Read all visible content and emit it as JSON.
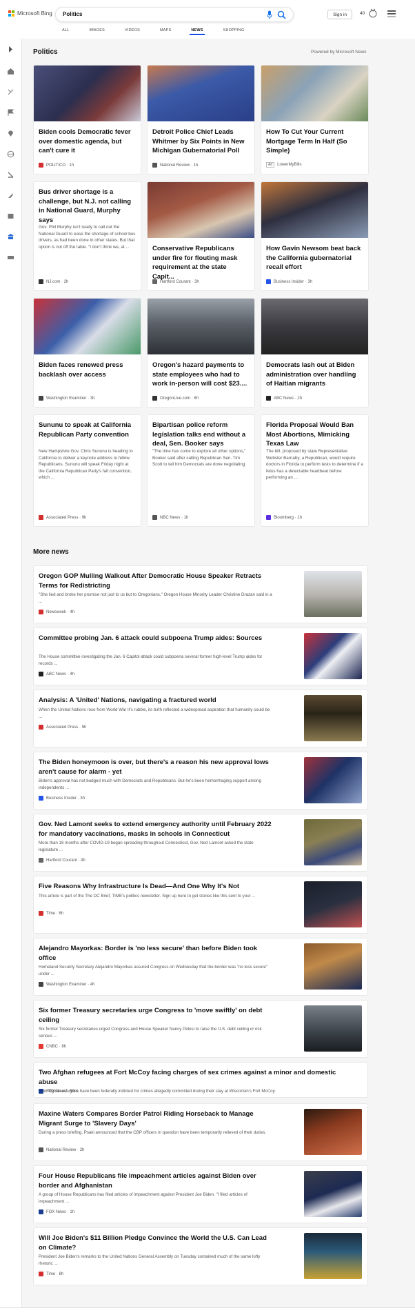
{
  "header": {
    "brand": "Microsoft Bing",
    "query": "Politics",
    "sign_in": "Sign in",
    "points": "40",
    "tabs": [
      "ALL",
      "IMAGES",
      "VIDEOS",
      "MAPS",
      "NEWS",
      "SHOPPING"
    ],
    "active_tab": "NEWS"
  },
  "politics": {
    "title": "Politics",
    "powered": "Powered by Microsoft News",
    "cards": [
      {
        "title": "Biden cools Democratic fever over domestic agenda, but can't cure it",
        "snippet": "",
        "source": "POLITICO",
        "time": "1h",
        "color": "#d32f2f"
      },
      {
        "title": "Detroit Police Chief Leads Whitmer by Six Points in New Michigan Gubernatorial Poll",
        "snippet": "",
        "source": "National Review",
        "time": "1h",
        "color": "#555555"
      },
      {
        "title": "How To Cut Your Current Mortgage Term In Half (So Simple)",
        "snippet": "",
        "source": "LowerMyBills",
        "time": "",
        "ad": "Ad",
        "color": "#888888"
      },
      {
        "title": "Bus driver shortage is a challenge, but N.J. not calling in National Guard, Murphy says",
        "snippet": "Gov. Phil Murphy isn't ready to call out the National Guard to ease the shortage of school bus drivers, as had been done in other states. But that option is not off the table. \"I don't think we, at ...",
        "source": "NJ.com",
        "time": "2h",
        "color": "#333333"
      },
      {
        "title": "Conservative Republicans under fire for flouting mask requirement at the state Capit...",
        "snippet": "",
        "source": "Hartford Courant",
        "time": "3h",
        "color": "#666666"
      },
      {
        "title": "How Gavin Newsom beat back the California gubernatorial recall effort",
        "snippet": "",
        "source": "Business Insider",
        "time": "3h",
        "color": "#2455e6"
      },
      {
        "title": "Biden faces renewed press backlash over access",
        "snippet": "",
        "source": "Washington Examiner",
        "time": "3h",
        "color": "#444444"
      },
      {
        "title": "Oregon's hazard payments to state employees who had to work in-person will cost $23....",
        "snippet": "",
        "source": "OregonLive.com",
        "time": "6h",
        "color": "#333333"
      },
      {
        "title": "Democrats lash out at Biden administration over handling of Haitian migrants",
        "snippet": "",
        "source": "ABC News",
        "time": "2h",
        "color": "#222222"
      },
      {
        "title": "Sununu to speak at California Republican Party convention",
        "snippet": "New Hampshire Gov. Chris Sununu is heading to California to deliver a keynote address to fellow Republicans. Sununu will speak Friday night at the California Republican Party's fall convention, which ...",
        "source": "Associated Press",
        "time": "9h",
        "color": "#d32f2f"
      },
      {
        "title": "Bipartisan police reform legislation talks end without a deal, Sen. Booker says",
        "snippet": "\"The time has come to explore all other options,\" Booker said after calling Republican Sen. Tim Scott to tell him Democrats are done negotiating.",
        "source": "NBC News",
        "time": "1h",
        "color": "#555555"
      },
      {
        "title": "Florida Proposal Would Ban Most Abortions, Mimicking Texas Law",
        "snippet": "The bill, proposed by state Representative Webster Barnaby, a Republican, would require doctors in Florida to perform tests to determine if a fetus has a detectable heartbeat before performing an ...",
        "source": "Bloomberg",
        "time": "1h",
        "color": "#5b2ee0"
      }
    ]
  },
  "more_news": {
    "title": "More news",
    "items": [
      {
        "title": "Oregon GOP Mulling Walkout After Democratic House Speaker Retracts Terms for Redistricting",
        "snippet": "\"She lied and broke her promise not just to us but to Oregonians,\" Oregon House Minority Leader Christine Drazan said in a ...",
        "source": "Newsweek",
        "time": "4h",
        "color": "#d32f2f"
      },
      {
        "title": "Committee probing Jan. 6 attack could subpoena Trump aides: Sources",
        "snippet": "The House committee investigating the Jan. 6 Capitol attack could subpoena several former high-level Trump aides for records ...",
        "source": "ABC News",
        "time": "4h",
        "color": "#222222"
      },
      {
        "title": "Analysis: A 'United' Nations, navigating a fractured world",
        "snippet": "When the United Nations rose from World War II's rubble, its birth reflected a widespread aspiration that humanity could be ...",
        "source": "Associated Press",
        "time": "5h",
        "color": "#d32f2f"
      },
      {
        "title": "The Biden honeymoon is over, but there's a reason his new approval lows aren't cause for alarm - yet",
        "snippet": "Biden's approval has not budged much with Democrats and Republicans. But he's been hemorrhaging support among independents ...",
        "source": "Business Insider",
        "time": "3h",
        "color": "#2455e6"
      },
      {
        "title": "Gov. Ned Lamont seeks to extend emergency authority until February 2022 for mandatory vaccinations, masks in schools in Connecticut",
        "snippet": "More than 18 months after COVID-19 began spreading throughout Connecticut, Gov. Ned Lamont asked the state legislature ...",
        "source": "Hartford Courant",
        "time": "4h",
        "color": "#666666"
      },
      {
        "title": "Five Reasons Why Infrastructure Is Dead—And One Why It's Not",
        "snippet": "This article is part of the The DC Brief, TIME's politics newsletter. Sign up here to get stories like this sent to your ...",
        "source": "Time",
        "time": "6h",
        "color": "#d32f2f"
      },
      {
        "title": "Alejandro Mayorkas: Border is 'no less secure' than before Biden took office",
        "snippet": "Homeland Security Secretary Alejandro Mayorkas assured Congress on Wednesday that the border was \"no less secure\" under ...",
        "source": "Washington Examiner",
        "time": "4h",
        "color": "#444444"
      },
      {
        "title": "Six former Treasury secretaries urge Congress to 'move swiftly' on debt ceiling",
        "snippet": "Six former Treasury secretaries urged Congress and House Speaker Nancy Pelosi to raise the U.S. debt ceiling or risk serious ...",
        "source": "CNBC",
        "time": "8h",
        "color": "#e53935"
      },
      {
        "title": "Two Afghan refugees at Fort McCoy facing charges of sex crimes against a minor and domestic abuse",
        "snippet": "Two Afghan refugees have been federally indicted for crimes allegedly committed during their stay at Wisconsin's Fort McCoy.",
        "source": "FOX News",
        "time": "59m",
        "color": "#1a3d8f"
      },
      {
        "title": "Maxine Waters Compares Border Patrol Riding Horseback to Manage Migrant Surge to 'Slavery Days'",
        "snippet": "During a press briefing, Psaki announced that the CBP officers in question have been temporarily relieved of their duties.",
        "source": "National Review",
        "time": "2h",
        "color": "#555555"
      },
      {
        "title": "Four House Republicans file impeachment articles against Biden over border and Afghanistan",
        "snippet": "A group of House Republicans has filed articles of impeachment against President Joe Biden. \"I filed articles of impeachment ...",
        "source": "FOX News",
        "time": "1h",
        "color": "#1a3d8f"
      },
      {
        "title": "Will Joe Biden's $11 Billion Pledge Convince the World the U.S. Can Lead on Climate?",
        "snippet": "President Joe Biden's remarks to the United Nations General Assembly on Tuesday contained much of the same lofty rhetoric ...",
        "source": "Time",
        "time": "8h",
        "color": "#d32f2f"
      }
    ]
  }
}
